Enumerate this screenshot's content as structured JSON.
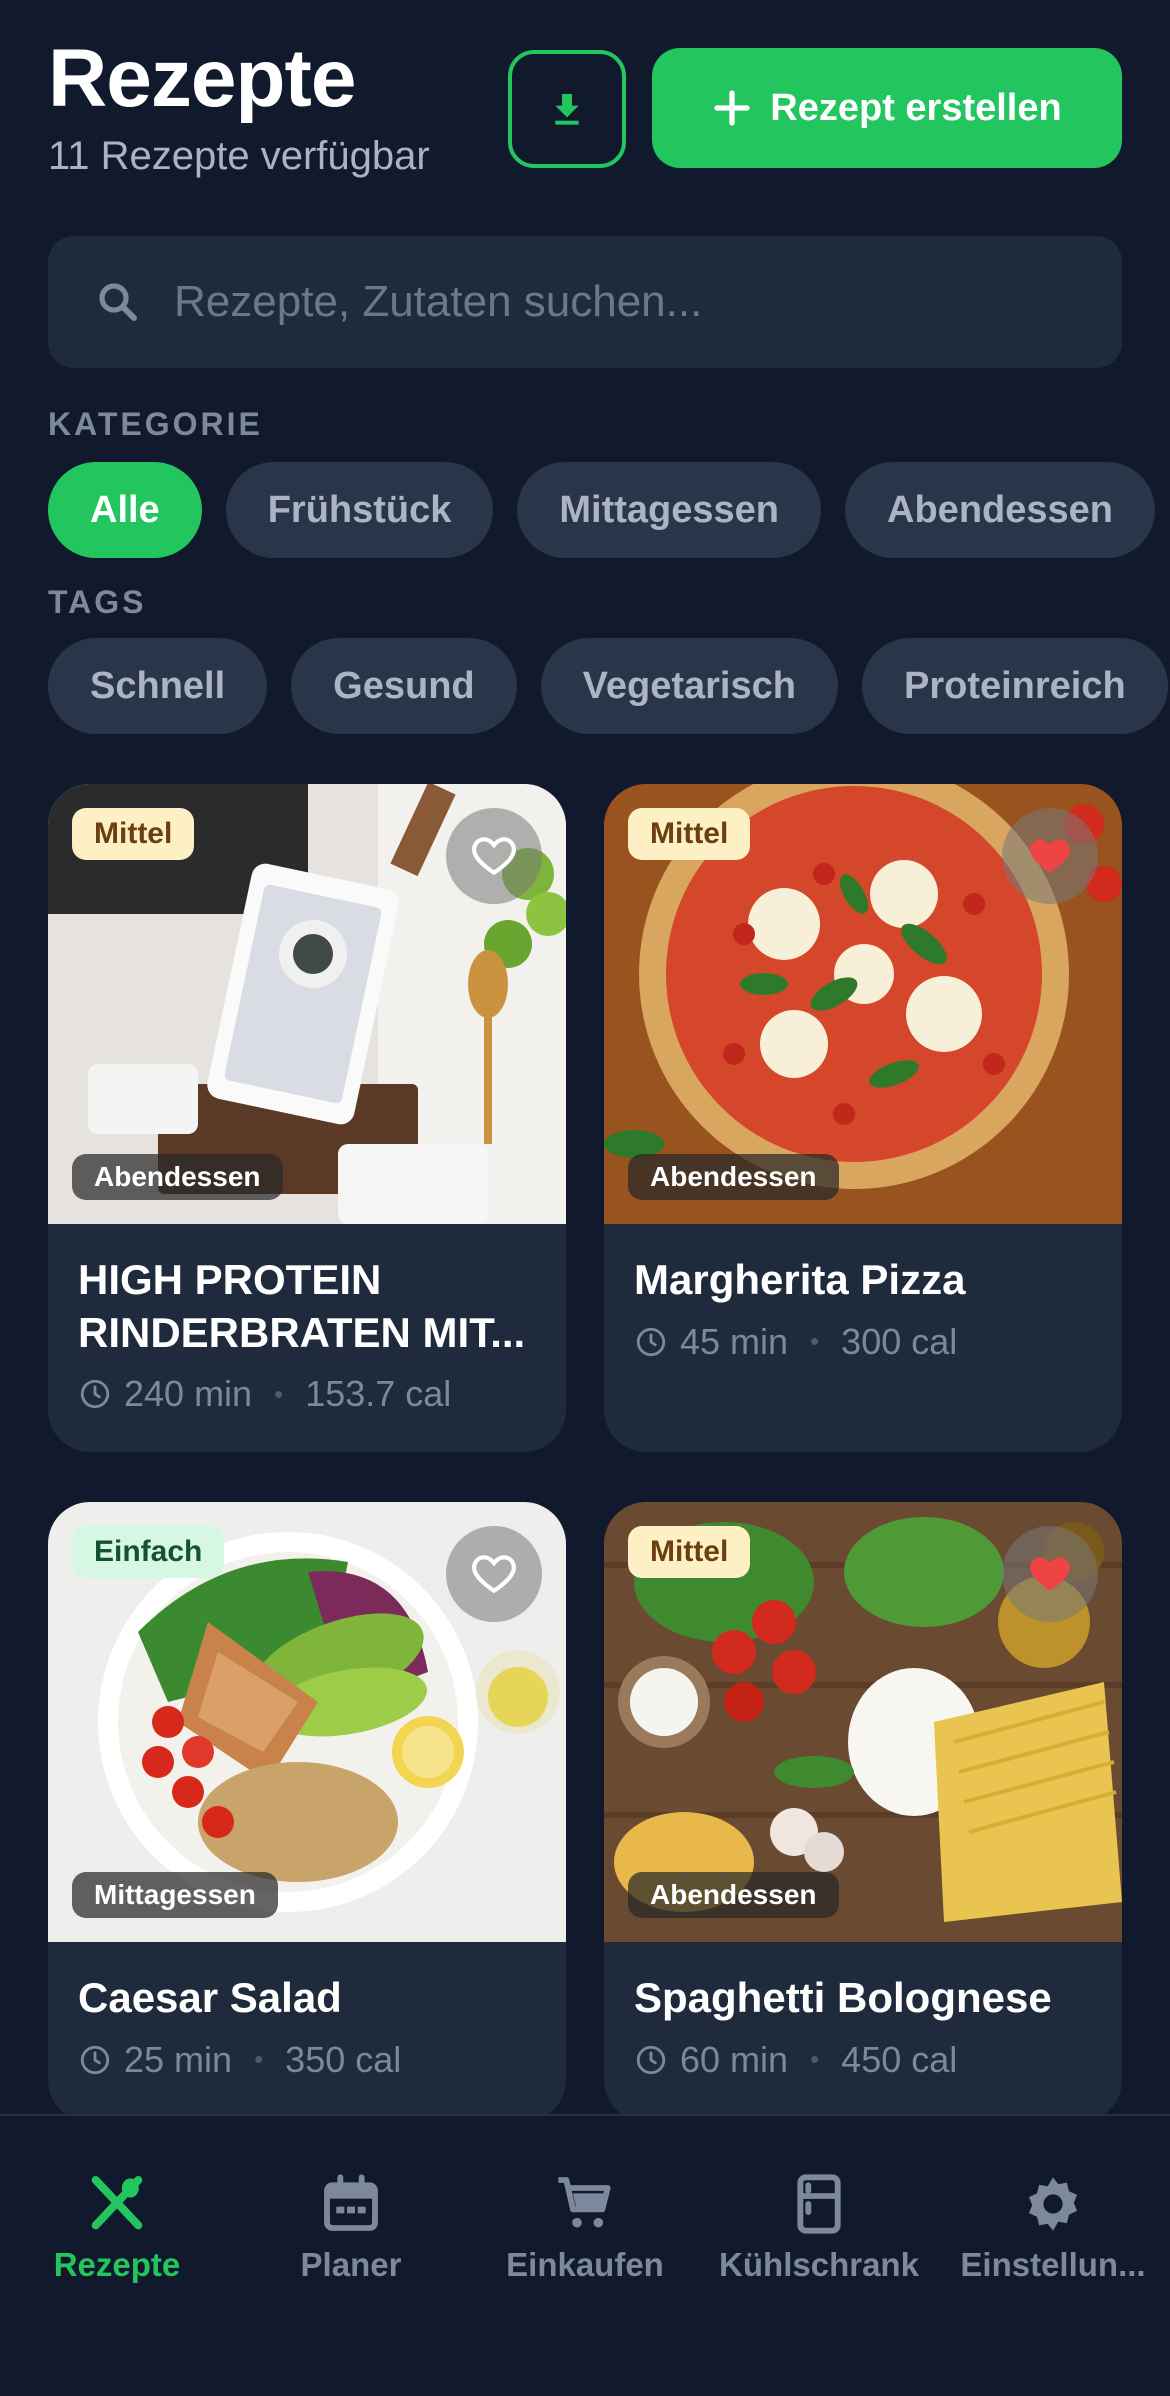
{
  "header": {
    "title": "Rezepte",
    "subtitle": "11 Rezepte verfügbar",
    "create_label": "Rezept erstellen"
  },
  "search": {
    "placeholder": "Rezepte, Zutaten suchen..."
  },
  "filters": {
    "category_label": "KATEGORIE",
    "categories": [
      "Alle",
      "Frühstück",
      "Mittagessen",
      "Abendessen"
    ],
    "selected_category": "Alle",
    "tags_label": "TAGS",
    "tags": [
      "Schnell",
      "Gesund",
      "Vegetarisch",
      "Proteinreich"
    ]
  },
  "recipes": [
    {
      "title": "HIGH PROTEIN RINDERBRATEN MIT...",
      "difficulty": "Mittel",
      "category": "Abendessen",
      "time": "240 min",
      "calories": "153.7 cal",
      "favorite": false
    },
    {
      "title": "Margherita Pizza",
      "difficulty": "Mittel",
      "category": "Abendessen",
      "time": "45 min",
      "calories": "300 cal",
      "favorite": true
    },
    {
      "title": "Caesar Salad",
      "difficulty": "Einfach",
      "category": "Mittagessen",
      "time": "25 min",
      "calories": "350 cal",
      "favorite": false
    },
    {
      "title": "Spaghetti Bolognese",
      "difficulty": "Mittel",
      "category": "Abendessen",
      "time": "60 min",
      "calories": "450 cal",
      "favorite": true
    }
  ],
  "nav": [
    {
      "label": "Rezepte",
      "icon": "utensils-icon",
      "active": true
    },
    {
      "label": "Planer",
      "icon": "calendar-icon",
      "active": false
    },
    {
      "label": "Einkaufen",
      "icon": "cart-icon",
      "active": false
    },
    {
      "label": "Kühlschrank",
      "icon": "fridge-icon",
      "active": false
    },
    {
      "label": "Einstellun...",
      "icon": "gear-icon",
      "active": false
    }
  ],
  "colors": {
    "accent": "#22c55e",
    "background": "#111a2c",
    "card": "#1f2a3d",
    "favorite": "#ef4444"
  }
}
